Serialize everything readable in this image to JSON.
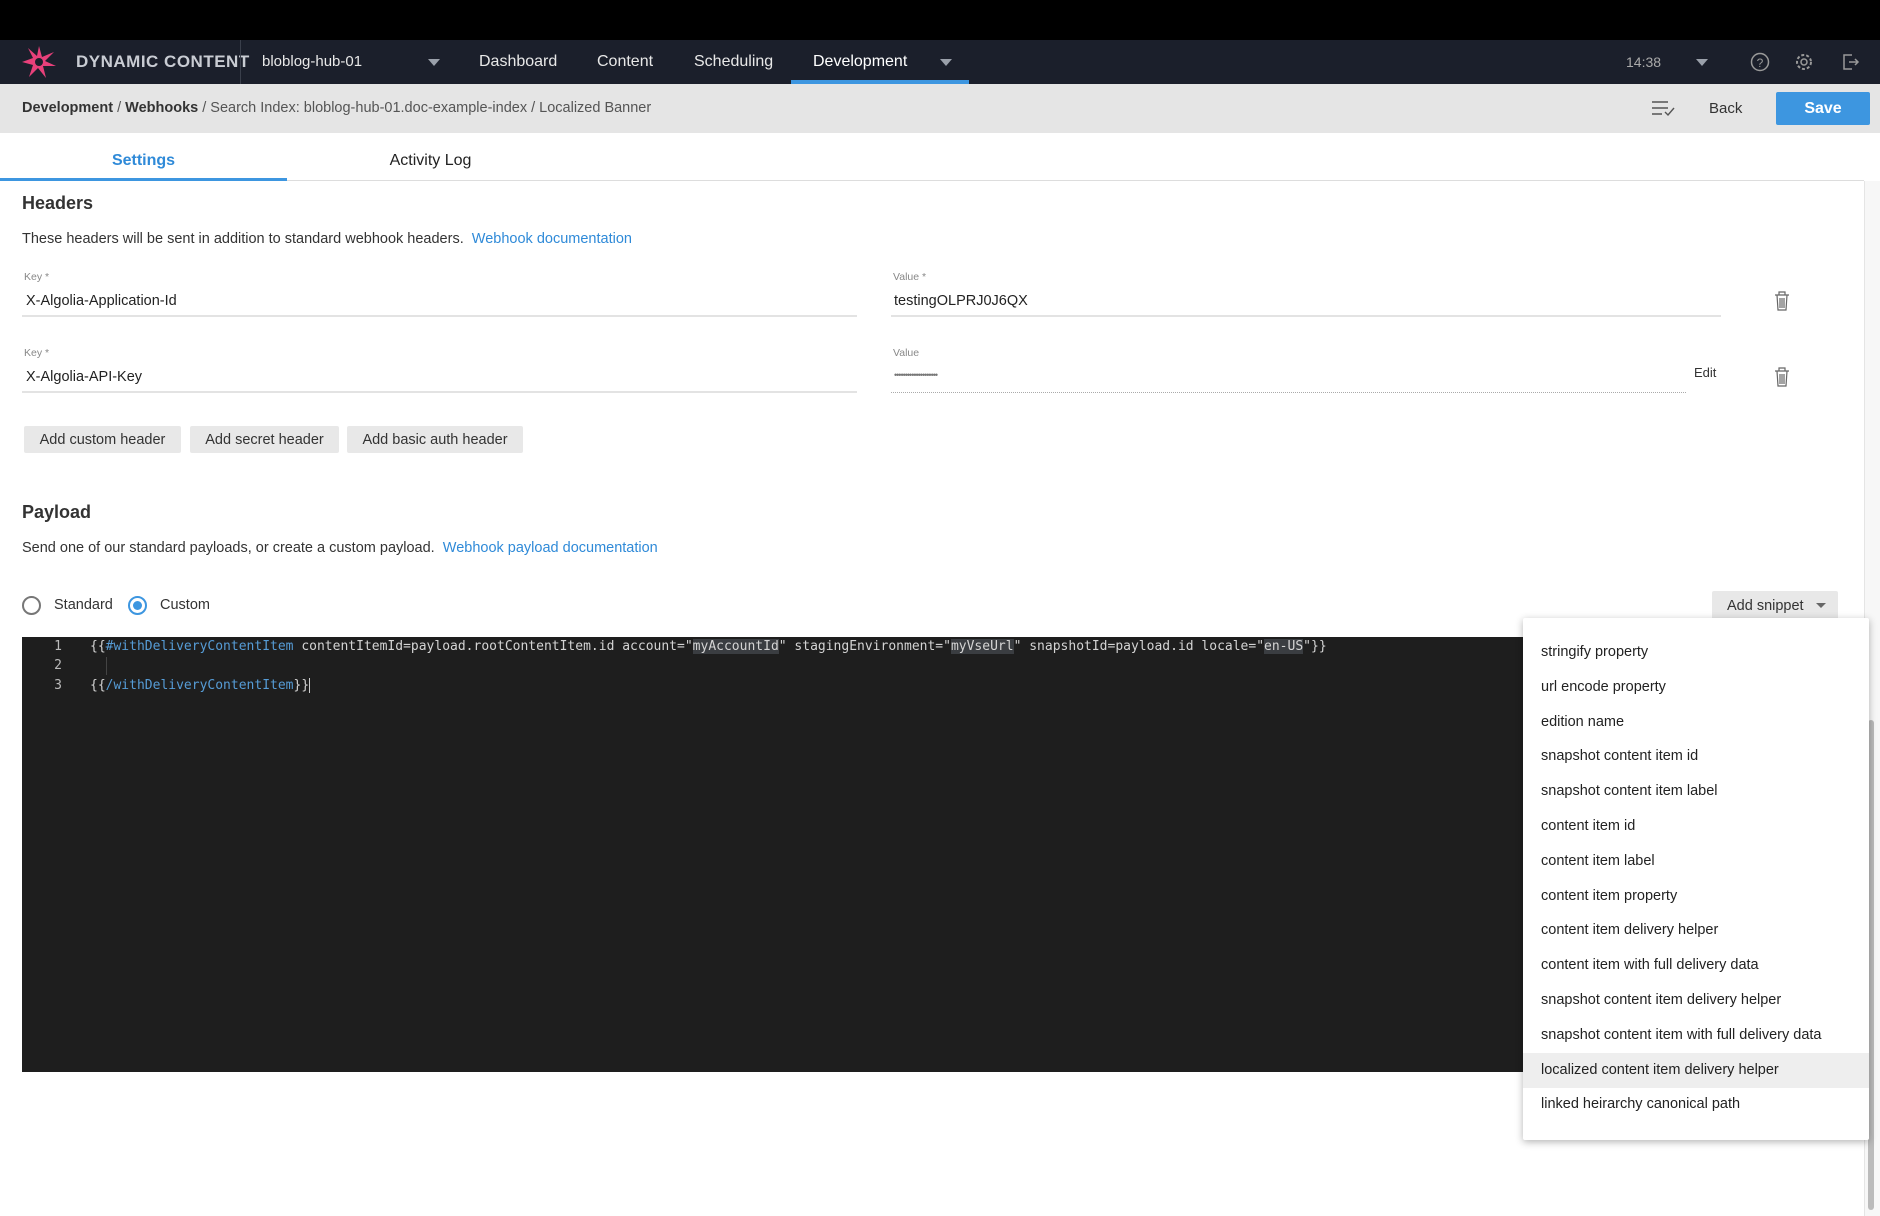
{
  "nav": {
    "brand": "DYNAMIC CONTENT",
    "hub": "bloblog-hub-01",
    "items": [
      "Dashboard",
      "Content",
      "Scheduling",
      "Development"
    ],
    "active": "Development",
    "time": "14:38",
    "accent": "#3d96e0"
  },
  "breadcrumb": {
    "items": [
      "Development",
      "Webhooks"
    ],
    "rest": "/ Search Index: bloblog-hub-01.doc-example-index / Localized Banner",
    "back": "Back",
    "save": "Save"
  },
  "tabs": [
    "Settings",
    "Activity Log"
  ],
  "headers": {
    "title": "Headers",
    "description": "These headers will be sent in addition to standard webhook headers.",
    "doc_link": "Webhook documentation",
    "rows": [
      {
        "key_label": "Key *",
        "key": "X-Algolia-Application-Id",
        "value_label": "Value *",
        "value": "testingOLPRJ0J6QX"
      },
      {
        "key_label": "Key *",
        "key": "X-Algolia-API-Key",
        "value_label": "Value",
        "value": "••••••••••••••••••••",
        "edit": "Edit"
      }
    ],
    "buttons": [
      "Add custom header",
      "Add secret header",
      "Add basic auth header"
    ]
  },
  "payload": {
    "title": "Payload",
    "description": "Send one of our standard payloads, or create a custom payload.",
    "doc_link": "Webhook payload documentation",
    "options": [
      "Standard",
      "Custom"
    ],
    "selected": "Custom",
    "add_snippet": "Add snippet",
    "code": {
      "l1a": "{{",
      "l1b": "#withDeliveryContentItem",
      "l1c": " contentItemId=payload.rootContentItem.id account=\"",
      "l1d": "myAccountId",
      "l1e": "\" stagingEnvironment=\"",
      "l1f": "myVseUrl",
      "l1g": "\" snapshotId=payload.id locale=\"",
      "l1h": "en-US",
      "l1i": "\"}}",
      "l3a": "{{",
      "l3b": "/withDeliveryContentItem",
      "l3c": "}}"
    },
    "line_numbers": [
      "1",
      "2",
      "3"
    ]
  },
  "snippets": {
    "items": [
      "stringify property",
      "url encode property",
      "edition name",
      "snapshot content item id",
      "snapshot content item label",
      "content item id",
      "content item label",
      "content item property",
      "content item delivery helper",
      "content item with full delivery data",
      "snapshot content item delivery helper",
      "snapshot content item with full delivery data",
      "localized content item delivery helper",
      "linked heirarchy canonical path"
    ],
    "highlighted": "localized content item delivery helper"
  }
}
